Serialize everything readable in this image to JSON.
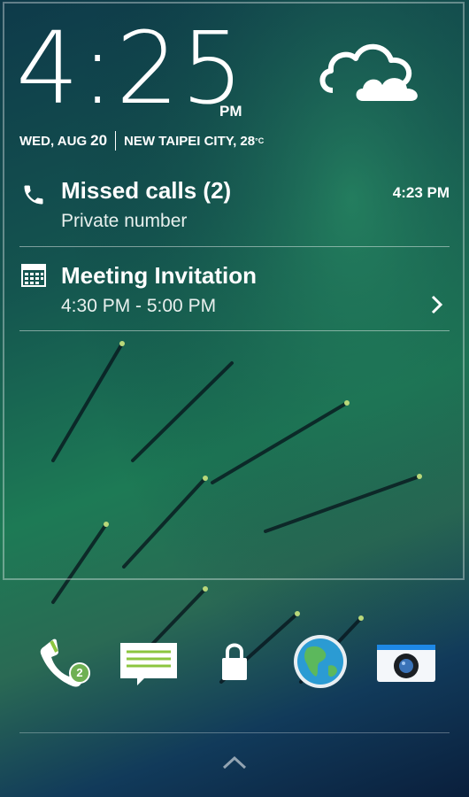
{
  "clock": {
    "time": "4:25",
    "ampm": "PM"
  },
  "date": {
    "weekday_month": "WED, AUG",
    "day": "20",
    "location_temp": "NEW TAIPEI CITY, 28",
    "unit": "°C"
  },
  "weather": {
    "icon": "cloudy-icon"
  },
  "notifications": [
    {
      "icon": "phone-icon",
      "title": "Missed calls (2)",
      "subtitle": "Private number",
      "time": "4:23 PM"
    },
    {
      "icon": "calendar-icon",
      "title": "Meeting Invitation",
      "subtitle": "4:30 PM - 5:00 PM"
    }
  ],
  "dock": {
    "items": [
      {
        "name": "phone",
        "icon": "phone-app-icon",
        "badge": "2"
      },
      {
        "name": "messages",
        "icon": "messages-app-icon"
      },
      {
        "name": "lock",
        "icon": "lock-icon"
      },
      {
        "name": "browser",
        "icon": "globe-icon"
      },
      {
        "name": "camera",
        "icon": "camera-app-icon"
      }
    ]
  },
  "colors": {
    "badge": "#6fb052",
    "message_lines": "#8cc63f",
    "camera_blue": "#1e88e5"
  }
}
